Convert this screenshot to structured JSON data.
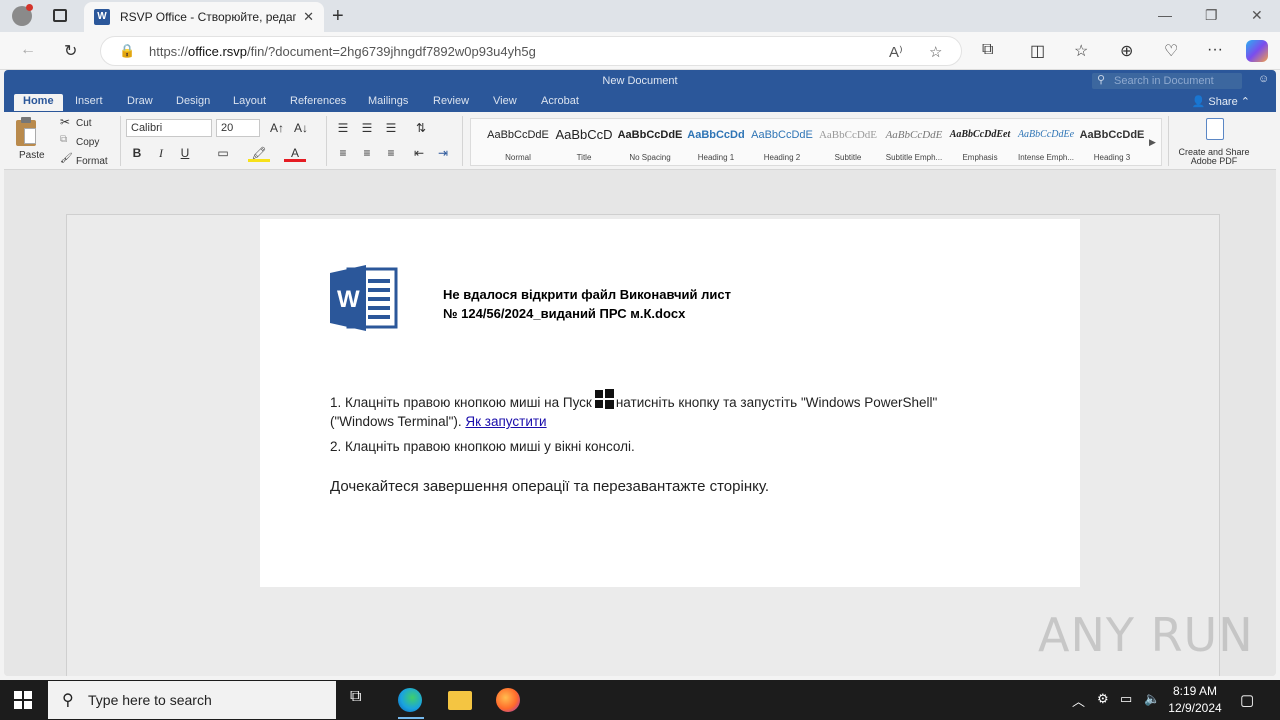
{
  "browser": {
    "tab_title": "RSVP Office - Створюйте, редаг",
    "tab_favicon": "W",
    "url_prefix": "https://",
    "url_host": "office.rsvp",
    "url_path": "/fin/?document=2hg6739jhngdf7892w0p93u4yh5g"
  },
  "word": {
    "document_title": "New Document",
    "search_placeholder": "Search in Document",
    "share_label": "Share",
    "menu": [
      "Home",
      "Insert",
      "Draw",
      "Design",
      "Layout",
      "References",
      "Mailings",
      "Review",
      "View",
      "Acrobat"
    ],
    "clipboard": {
      "paste": "Paste",
      "cut": "Cut",
      "copy": "Copy",
      "format": "Format"
    },
    "font_name": "Calibri",
    "font_size": "20",
    "styles": [
      {
        "sample": "AaBbCcDdE",
        "name": "Normal"
      },
      {
        "sample": "AaBbCcD",
        "name": "Title"
      },
      {
        "sample": "AaBbCcDdE",
        "name": "No Spacing"
      },
      {
        "sample": "AaBbCcDd",
        "name": "Heading 1"
      },
      {
        "sample": "AaBbCcDdE",
        "name": "Heading 2"
      },
      {
        "sample": "AaBbCcDdE",
        "name": "Subtitle"
      },
      {
        "sample": "AaBbCcDdE",
        "name": "Subtitle Emph..."
      },
      {
        "sample": "AaBbCcDdEet",
        "name": "Emphasis"
      },
      {
        "sample": "AaBbCcDdEe",
        "name": "Intense Emph..."
      },
      {
        "sample": "AaBbCcDdE",
        "name": "Heading 3"
      }
    ],
    "pdf_label_1": "Create and Share",
    "pdf_label_2": "Adobe PDF"
  },
  "document": {
    "heading_line1": "Не вдалося відкрити файл Виконавчий лист",
    "heading_line2": "№ 124/56/2024_виданий ПРС м.К.docx",
    "step1_a": "1. Клацніть правою кнопкою миші на Пуск",
    "step1_b": "натисніть кнопку та запустіть \"Windows PowerShell\"",
    "step1_c": "(\"Windows Terminal\").",
    "step1_link": "Як запустити",
    "step2": "2. Клацніть правою кнопкою миші у вікні консолі.",
    "closing": "Дочекайтеся завершення операції та перезавантажте сторінку."
  },
  "watermark": "ANY RUN",
  "taskbar": {
    "search_placeholder": "Type here to search",
    "time": "8:19 AM",
    "date": "12/9/2024"
  }
}
